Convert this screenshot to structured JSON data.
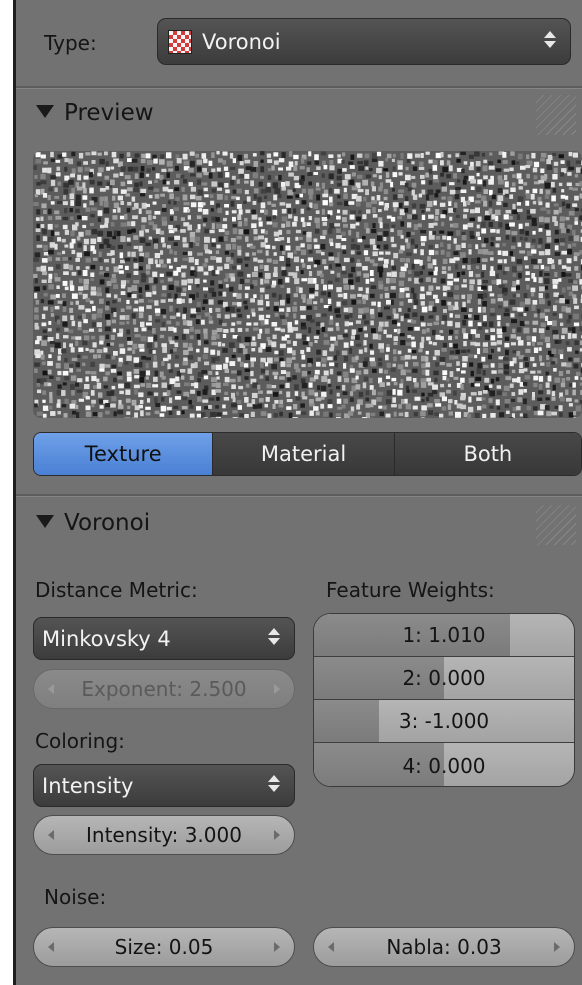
{
  "type_row": {
    "label": "Type:",
    "value": "Voronoi",
    "icon": "checker-texture-icon"
  },
  "preview": {
    "header": "Preview",
    "tabs": [
      {
        "label": "Texture",
        "active": true
      },
      {
        "label": "Material",
        "active": false
      },
      {
        "label": "Both",
        "active": false
      }
    ]
  },
  "voronoi": {
    "header": "Voronoi",
    "distance_metric_label": "Distance Metric:",
    "distance_metric_value": "Minkovsky 4",
    "exponent": "Exponent: 2.500",
    "coloring_label": "Coloring:",
    "coloring_value": "Intensity",
    "intensity": "Intensity: 3.000",
    "feature_weights_label": "Feature Weights:",
    "weights": [
      {
        "label": "1: 1.010",
        "value": 1.01
      },
      {
        "label": "2: 0.000",
        "value": 0.0
      },
      {
        "label": "3: -1.000",
        "value": -1.0
      },
      {
        "label": "4: 0.000",
        "value": 0.0
      }
    ],
    "weight_range": [
      -2,
      2
    ],
    "noise_label": "Noise:",
    "size": "Size: 0.05",
    "nabla": "Nabla: 0.03"
  },
  "colors": {
    "panel_bg": "#727272",
    "active_tab": "#5a8fdc"
  }
}
